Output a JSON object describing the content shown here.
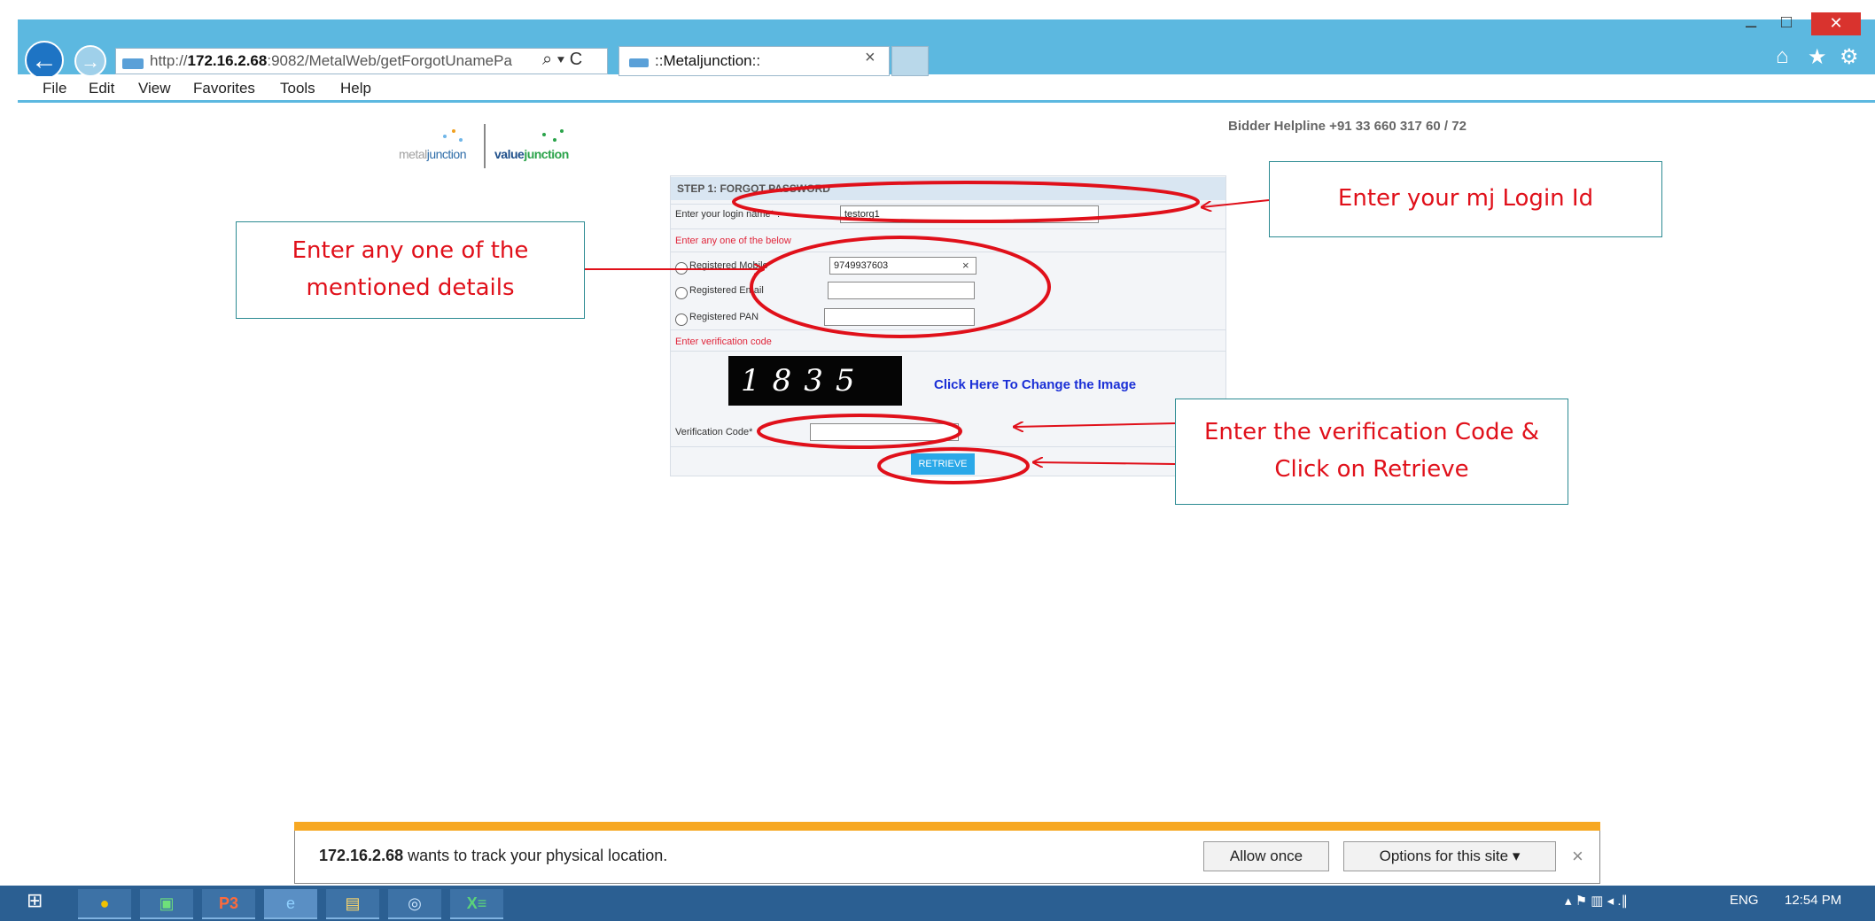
{
  "browser": {
    "url_prefix": "http://",
    "url_host": "172.16.2.68",
    "url_rest": ":9082/MetalWeb/getForgotUnamePa",
    "url_tools": "⌕ ▾ C",
    "tab_title": "::Metaljunction::",
    "tab_close": "×",
    "back": "←",
    "forward": "→",
    "min": "–",
    "max": "□",
    "close": "✕",
    "home": "⌂",
    "favorites": "★",
    "settings": "⚙"
  },
  "menu": {
    "file": "File",
    "edit": "Edit",
    "view": "View",
    "favorites": "Favorites",
    "tools": "Tools",
    "help": "Help"
  },
  "logo": {
    "metal_a": "metal",
    "metal_b": "junction",
    "value_a": "value",
    "value_b": "junction"
  },
  "helpline": "Bidder Helpline +91 33 660 317 60 / 72",
  "form": {
    "title": "STEP 1: FORGOT PASSWORD",
    "login_label": "Enter your login name* :",
    "login_value": "testorg1",
    "any_one": "Enter any one of the below",
    "mobile_label": "Registered Mobile",
    "mobile_value": "9749937603",
    "mobile_clear": "×",
    "email_label": "Registered Email",
    "pan_label": "Registered PAN",
    "verification_heading": "Enter verification code",
    "captcha": "1835",
    "change_image": "Click Here To Change the Image",
    "code_label": "Verification Code*",
    "retrieve": "RETRIEVE"
  },
  "callouts": {
    "login": "Enter your mj Login Id",
    "details_1": "Enter any one of the",
    "details_2": "mentioned details",
    "verify_1": "Enter the verification Code &",
    "verify_2": "Click on Retrieve"
  },
  "notification": {
    "host": "172.16.2.68",
    "message": " wants to track your physical location.",
    "allow": "Allow once",
    "options": "Options for this site ▾",
    "close": "×"
  },
  "taskbar": {
    "start": "⊞",
    "chrome": "●",
    "app2": "▣",
    "powerpoint": "P3",
    "ie": "e",
    "explorer": "▤",
    "ie2": "◎",
    "excel": "X≡",
    "tray_icons": "▴  ⚑  ▥  ◂  .∥",
    "lang": "ENG",
    "time": "12:54 PM"
  },
  "colors": {
    "chrome_blue": "#5cb8e0",
    "annotation_red": "#e0101a",
    "callout_border": "#2b8a92",
    "notif_orange": "#f7a823",
    "taskbar": "#2b5f92"
  }
}
